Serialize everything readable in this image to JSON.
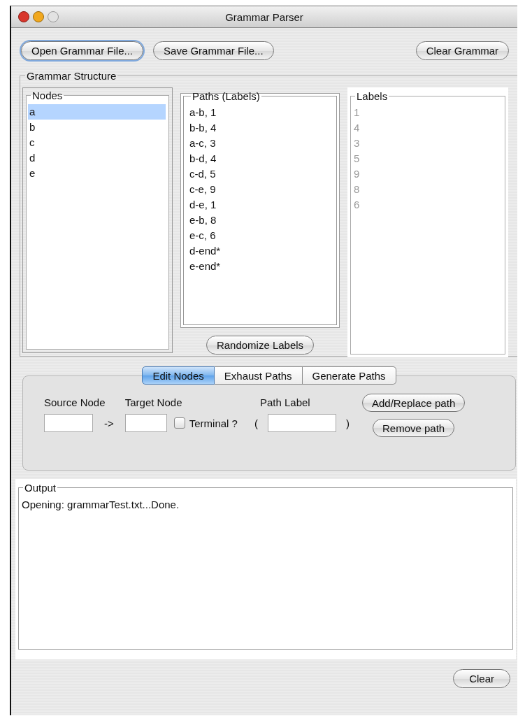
{
  "window": {
    "title": "Grammar Parser"
  },
  "toolbar": [
    {
      "label": "Open Grammar File...",
      "focused": true
    },
    {
      "label": "Save Grammar File...",
      "focused": false
    },
    {
      "label": "Clear Grammar",
      "focused": false
    }
  ],
  "grammar_structure": {
    "title": "Grammar Structure",
    "nodes": {
      "title": "Nodes",
      "items": [
        {
          "label": "a",
          "selected": true
        },
        {
          "label": "b",
          "selected": false
        },
        {
          "label": "c",
          "selected": false
        },
        {
          "label": "d",
          "selected": false
        },
        {
          "label": "e",
          "selected": false
        }
      ]
    },
    "paths": {
      "title": "Paths (Labels)",
      "items": [
        "a-b, 1",
        "b-b, 4",
        "a-c, 3",
        "b-d, 4",
        "c-d, 5",
        "c-e, 9",
        "d-e, 1",
        "e-b, 8",
        "e-c, 6",
        "d-end*",
        "e-end*"
      ]
    },
    "randomize_button": "Randomize Labels",
    "labels": {
      "title": "Labels",
      "disabled": true,
      "items": [
        "1",
        "4",
        "3",
        "5",
        "9",
        "8",
        "6"
      ]
    }
  },
  "tabs": [
    {
      "label": "Edit Nodes",
      "selected": true
    },
    {
      "label": "Exhaust Paths",
      "selected": false
    },
    {
      "label": "Generate Paths",
      "selected": false
    }
  ],
  "edit_form": {
    "source_label": "Source Node",
    "arrow": "->",
    "target_label": "Target Node",
    "terminal": {
      "label": "Terminal ?",
      "checked": false
    },
    "open_paren": "(",
    "path_label": "Path Label",
    "close_paren": ")",
    "buttons": [
      "Add/Replace path",
      "Remove path"
    ]
  },
  "output": {
    "title": "Output",
    "lines": [
      "Opening: grammarTest.txt...Done."
    ]
  },
  "clear_button": "Clear"
}
